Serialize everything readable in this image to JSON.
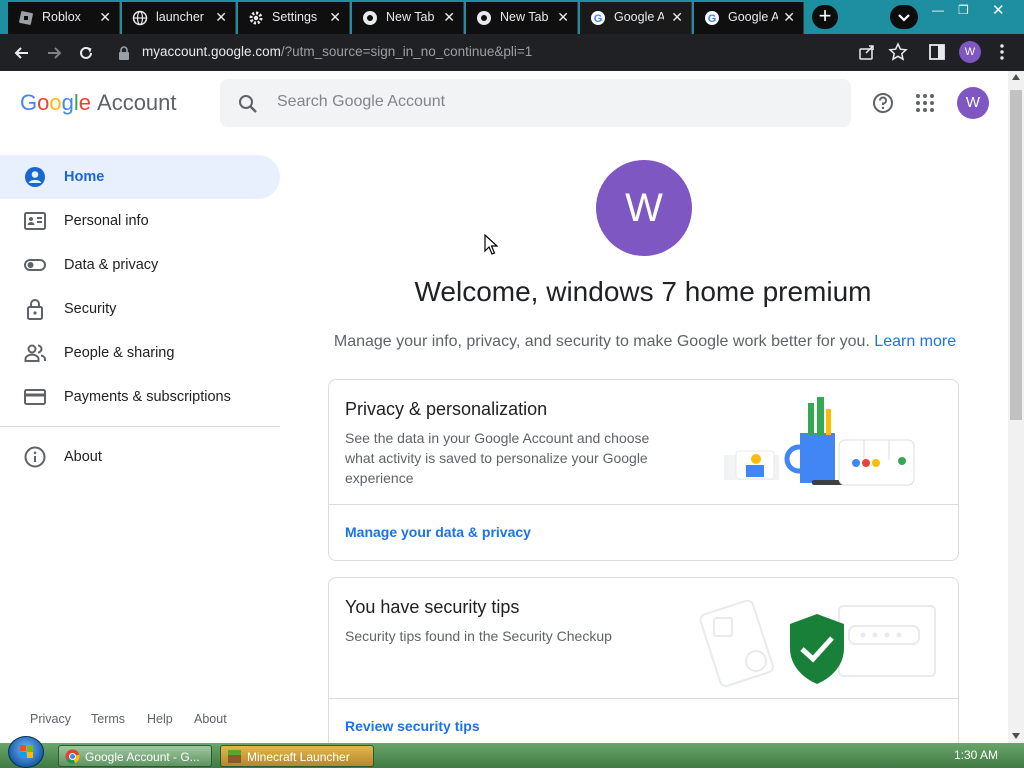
{
  "browser": {
    "tabs": [
      {
        "label": "Roblox",
        "active": false
      },
      {
        "label": "launcher",
        "active": false
      },
      {
        "label": "Settings",
        "active": false
      },
      {
        "label": "New Tab",
        "active": false
      },
      {
        "label": "New Tab",
        "active": false
      },
      {
        "label": "Google A",
        "active": true
      },
      {
        "label": "Google A",
        "active": false
      }
    ],
    "url_host": "myaccount.google.com",
    "url_rest": "/?utm_source=sign_in_no_continue&pli=1",
    "profile_initial": "W"
  },
  "header": {
    "logo_letters": [
      "G",
      "o",
      "o",
      "g",
      "l",
      "e"
    ],
    "logo_suffix": "Account",
    "search_placeholder": "Search Google Account",
    "avatar_initial": "W"
  },
  "sidebar": {
    "items": [
      {
        "label": "Home",
        "icon": "person-circle-icon",
        "active": true
      },
      {
        "label": "Personal info",
        "icon": "id-card-icon",
        "active": false
      },
      {
        "label": "Data & privacy",
        "icon": "toggle-icon",
        "active": false
      },
      {
        "label": "Security",
        "icon": "lock-icon",
        "active": false
      },
      {
        "label": "People & sharing",
        "icon": "people-icon",
        "active": false
      },
      {
        "label": "Payments & subscriptions",
        "icon": "credit-card-icon",
        "active": false
      }
    ],
    "about_label": "About",
    "footer_links": [
      "Privacy",
      "Terms",
      "Help",
      "About"
    ]
  },
  "main": {
    "avatar_initial": "W",
    "welcome": "Welcome, windows 7 home premium",
    "subtitle": "Manage your info, privacy, and security to make Google work better for you.",
    "learn_more": "Learn more",
    "cards": [
      {
        "title": "Privacy & personalization",
        "description": "See the data in your Google Account and choose what activity is saved to personalize your Google experience",
        "link": "Manage your data & privacy"
      },
      {
        "title": "You have security tips",
        "description": "Security tips found in the Security Checkup",
        "link": "Review security tips"
      }
    ]
  },
  "taskbar": {
    "buttons": [
      "Google Account - G...",
      "Minecraft Launcher"
    ],
    "clock": "1:30 AM"
  },
  "colors": {
    "accent": "#1a73e8",
    "avatar": "#7e57c2",
    "active_nav_bg": "#e8f0fe",
    "shield": "#188038"
  }
}
